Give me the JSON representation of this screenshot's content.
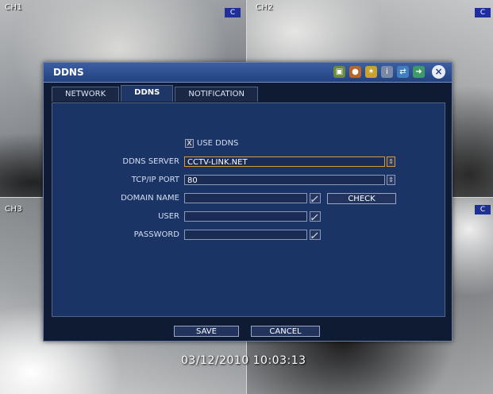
{
  "channels": {
    "ch1": "CH1",
    "ch2": "CH2",
    "ch3": "CH3",
    "badge": "C"
  },
  "dialog": {
    "title": "DDNS",
    "close_symbol": "×",
    "toolbar_icons": [
      "camera-icon",
      "record-icon",
      "event-icon",
      "system-icon",
      "network-icon",
      "exit-icon"
    ],
    "tabs": [
      {
        "label": "NETWORK",
        "active": false
      },
      {
        "label": "DDNS",
        "active": true
      },
      {
        "label": "NOTIFICATION",
        "active": false
      }
    ],
    "use_ddns": {
      "label": "USE DDNS",
      "checked": true,
      "mark": "X"
    },
    "fields": {
      "ddns_server": {
        "label": "DDNS SERVER",
        "value": "CCTV-LINK.NET"
      },
      "tcp_ip_port": {
        "label": "TCP/IP PORT",
        "value": "80"
      },
      "domain_name": {
        "label": "DOMAIN NAME",
        "value": ""
      },
      "user": {
        "label": "USER",
        "value": ""
      },
      "password": {
        "label": "PASSWORD",
        "value": ""
      }
    },
    "check_button": "CHECK",
    "save_button": "SAVE",
    "cancel_button": "CANCEL"
  },
  "timestamp": "03/12/2010 10:03:13",
  "colors": {
    "accent_orange": "#d89a3a",
    "titlebar_blue": "#2a4b8c",
    "panel_blue": "#1b3466"
  }
}
